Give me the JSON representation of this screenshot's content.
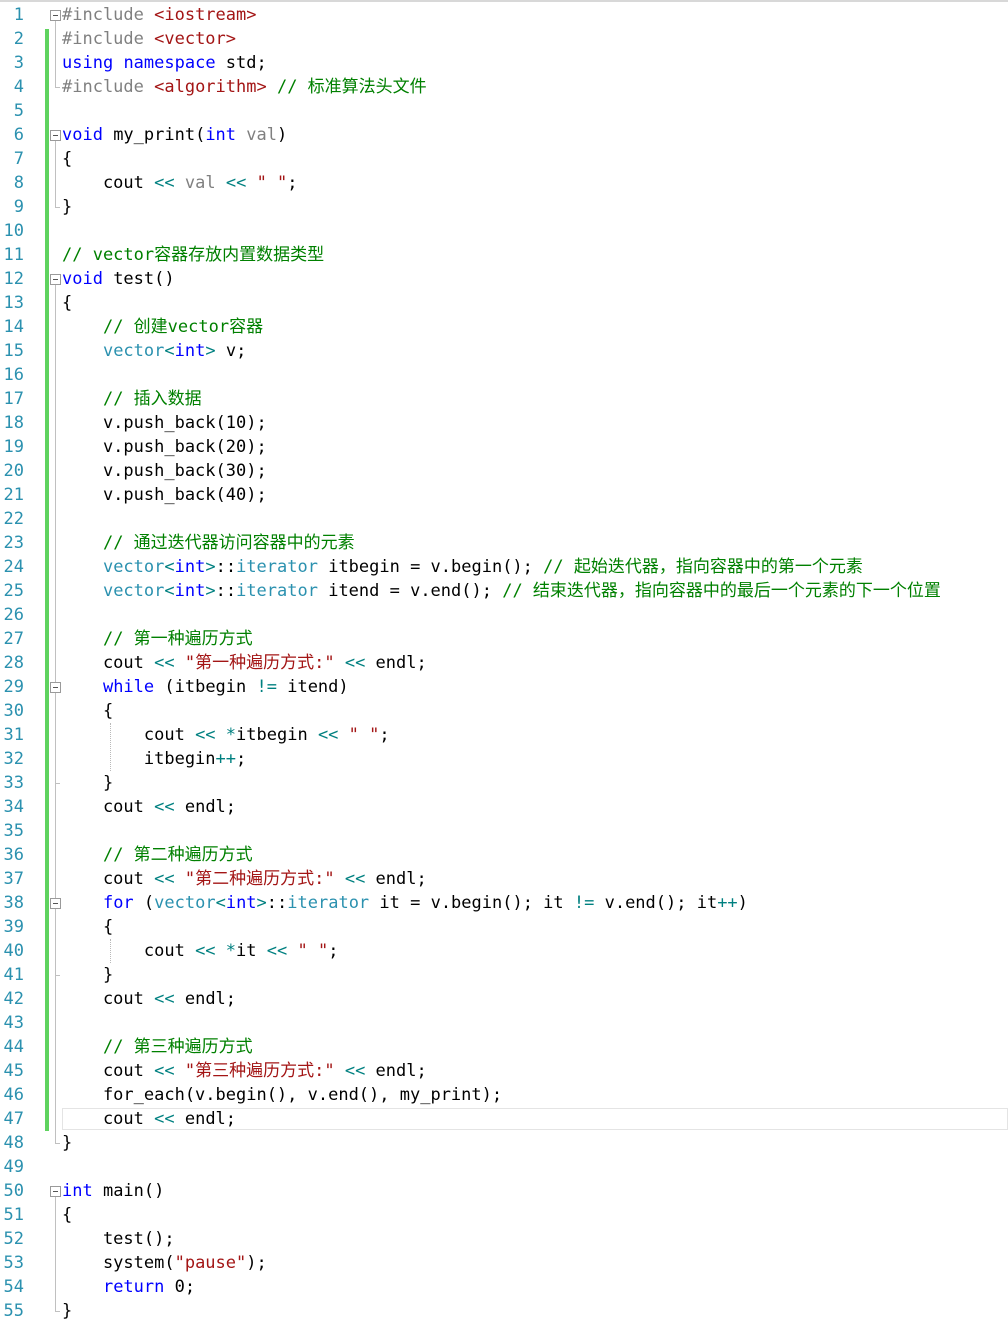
{
  "editor": {
    "language": "C++",
    "lines": [
      {
        "n": "1",
        "tokens": [
          [
            "pp",
            "#include "
          ],
          [
            "str",
            "<iostream>"
          ]
        ]
      },
      {
        "n": "2",
        "tokens": [
          [
            "pp",
            "#include "
          ],
          [
            "str",
            "<vector>"
          ]
        ]
      },
      {
        "n": "3",
        "tokens": [
          [
            "kw",
            "using"
          ],
          [
            "plain",
            " "
          ],
          [
            "kw",
            "namespace"
          ],
          [
            "plain",
            " std;"
          ]
        ]
      },
      {
        "n": "4",
        "tokens": [
          [
            "pp",
            "#include "
          ],
          [
            "str",
            "<algorithm>"
          ],
          [
            "plain",
            " "
          ],
          [
            "cm",
            "// 标准算法头文件"
          ]
        ]
      },
      {
        "n": "5",
        "tokens": []
      },
      {
        "n": "6",
        "tokens": [
          [
            "kw",
            "void"
          ],
          [
            "plain",
            " my_print("
          ],
          [
            "kw",
            "int"
          ],
          [
            "plain",
            " "
          ],
          [
            "par",
            "val"
          ],
          [
            "plain",
            ")"
          ]
        ]
      },
      {
        "n": "7",
        "tokens": [
          [
            "plain",
            "{"
          ]
        ]
      },
      {
        "n": "8",
        "tokens": [
          [
            "plain",
            "    cout "
          ],
          [
            "op",
            "<<"
          ],
          [
            "plain",
            " "
          ],
          [
            "par",
            "val"
          ],
          [
            "plain",
            " "
          ],
          [
            "op",
            "<<"
          ],
          [
            "plain",
            " "
          ],
          [
            "str",
            "\" \""
          ],
          [
            "plain",
            ";"
          ]
        ]
      },
      {
        "n": "9",
        "tokens": [
          [
            "plain",
            "}"
          ]
        ]
      },
      {
        "n": "10",
        "tokens": []
      },
      {
        "n": "11",
        "tokens": [
          [
            "cm",
            "// vector容器存放内置数据类型"
          ]
        ]
      },
      {
        "n": "12",
        "tokens": [
          [
            "kw",
            "void"
          ],
          [
            "plain",
            " test()"
          ]
        ]
      },
      {
        "n": "13",
        "tokens": [
          [
            "plain",
            "{"
          ]
        ]
      },
      {
        "n": "14",
        "tokens": [
          [
            "plain",
            "    "
          ],
          [
            "cm",
            "// 创建vector容器"
          ]
        ]
      },
      {
        "n": "15",
        "tokens": [
          [
            "plain",
            "    "
          ],
          [
            "ty",
            "vector"
          ],
          [
            "op",
            "<"
          ],
          [
            "kw",
            "int"
          ],
          [
            "op",
            ">"
          ],
          [
            "plain",
            " v;"
          ]
        ]
      },
      {
        "n": "16",
        "tokens": []
      },
      {
        "n": "17",
        "tokens": [
          [
            "plain",
            "    "
          ],
          [
            "cm",
            "// 插入数据"
          ]
        ]
      },
      {
        "n": "18",
        "tokens": [
          [
            "plain",
            "    v.push_back(10);"
          ]
        ]
      },
      {
        "n": "19",
        "tokens": [
          [
            "plain",
            "    v.push_back(20);"
          ]
        ]
      },
      {
        "n": "20",
        "tokens": [
          [
            "plain",
            "    v.push_back(30);"
          ]
        ]
      },
      {
        "n": "21",
        "tokens": [
          [
            "plain",
            "    v.push_back(40);"
          ]
        ]
      },
      {
        "n": "22",
        "tokens": []
      },
      {
        "n": "23",
        "tokens": [
          [
            "plain",
            "    "
          ],
          [
            "cm",
            "// 通过迭代器访问容器中的元素"
          ]
        ]
      },
      {
        "n": "24",
        "tokens": [
          [
            "plain",
            "    "
          ],
          [
            "ty",
            "vector"
          ],
          [
            "op",
            "<"
          ],
          [
            "kw",
            "int"
          ],
          [
            "op",
            ">"
          ],
          [
            "plain",
            "::"
          ],
          [
            "ty",
            "iterator"
          ],
          [
            "plain",
            " itbegin = v.begin(); "
          ],
          [
            "cm",
            "// 起始迭代器，指向容器中的第一个元素"
          ]
        ]
      },
      {
        "n": "25",
        "tokens": [
          [
            "plain",
            "    "
          ],
          [
            "ty",
            "vector"
          ],
          [
            "op",
            "<"
          ],
          [
            "kw",
            "int"
          ],
          [
            "op",
            ">"
          ],
          [
            "plain",
            "::"
          ],
          [
            "ty",
            "iterator"
          ],
          [
            "plain",
            " itend = v.end(); "
          ],
          [
            "cm",
            "// 结束迭代器，指向容器中的最后一个元素的下一个位置"
          ]
        ]
      },
      {
        "n": "26",
        "tokens": []
      },
      {
        "n": "27",
        "tokens": [
          [
            "plain",
            "    "
          ],
          [
            "cm",
            "// 第一种遍历方式"
          ]
        ]
      },
      {
        "n": "28",
        "tokens": [
          [
            "plain",
            "    cout "
          ],
          [
            "op",
            "<<"
          ],
          [
            "plain",
            " "
          ],
          [
            "str",
            "\"第一种遍历方式:\""
          ],
          [
            "plain",
            " "
          ],
          [
            "op",
            "<<"
          ],
          [
            "plain",
            " endl;"
          ]
        ]
      },
      {
        "n": "29",
        "tokens": [
          [
            "plain",
            "    "
          ],
          [
            "kw",
            "while"
          ],
          [
            "plain",
            " (itbegin "
          ],
          [
            "op",
            "!="
          ],
          [
            "plain",
            " itend)"
          ]
        ]
      },
      {
        "n": "30",
        "tokens": [
          [
            "plain",
            "    {"
          ]
        ]
      },
      {
        "n": "31",
        "tokens": [
          [
            "plain",
            "        cout "
          ],
          [
            "op",
            "<<"
          ],
          [
            "plain",
            " "
          ],
          [
            "op",
            "*"
          ],
          [
            "plain",
            "itbegin "
          ],
          [
            "op",
            "<<"
          ],
          [
            "plain",
            " "
          ],
          [
            "str",
            "\" \""
          ],
          [
            "plain",
            ";"
          ]
        ]
      },
      {
        "n": "32",
        "tokens": [
          [
            "plain",
            "        itbegin"
          ],
          [
            "op",
            "++"
          ],
          [
            "plain",
            ";"
          ]
        ]
      },
      {
        "n": "33",
        "tokens": [
          [
            "plain",
            "    }"
          ]
        ]
      },
      {
        "n": "34",
        "tokens": [
          [
            "plain",
            "    cout "
          ],
          [
            "op",
            "<<"
          ],
          [
            "plain",
            " endl;"
          ]
        ]
      },
      {
        "n": "35",
        "tokens": []
      },
      {
        "n": "36",
        "tokens": [
          [
            "plain",
            "    "
          ],
          [
            "cm",
            "// 第二种遍历方式"
          ]
        ]
      },
      {
        "n": "37",
        "tokens": [
          [
            "plain",
            "    cout "
          ],
          [
            "op",
            "<<"
          ],
          [
            "plain",
            " "
          ],
          [
            "str",
            "\"第二种遍历方式:\""
          ],
          [
            "plain",
            " "
          ],
          [
            "op",
            "<<"
          ],
          [
            "plain",
            " endl;"
          ]
        ]
      },
      {
        "n": "38",
        "tokens": [
          [
            "plain",
            "    "
          ],
          [
            "kw",
            "for"
          ],
          [
            "plain",
            " ("
          ],
          [
            "ty",
            "vector"
          ],
          [
            "op",
            "<"
          ],
          [
            "kw",
            "int"
          ],
          [
            "op",
            ">"
          ],
          [
            "plain",
            "::"
          ],
          [
            "ty",
            "iterator"
          ],
          [
            "plain",
            " it = v.begin(); it "
          ],
          [
            "op",
            "!="
          ],
          [
            "plain",
            " v.end(); it"
          ],
          [
            "op",
            "++"
          ],
          [
            "plain",
            ")"
          ]
        ]
      },
      {
        "n": "39",
        "tokens": [
          [
            "plain",
            "    {"
          ]
        ]
      },
      {
        "n": "40",
        "tokens": [
          [
            "plain",
            "        cout "
          ],
          [
            "op",
            "<<"
          ],
          [
            "plain",
            " "
          ],
          [
            "op",
            "*"
          ],
          [
            "plain",
            "it "
          ],
          [
            "op",
            "<<"
          ],
          [
            "plain",
            " "
          ],
          [
            "str",
            "\" \""
          ],
          [
            "plain",
            ";"
          ]
        ]
      },
      {
        "n": "41",
        "tokens": [
          [
            "plain",
            "    }"
          ]
        ]
      },
      {
        "n": "42",
        "tokens": [
          [
            "plain",
            "    cout "
          ],
          [
            "op",
            "<<"
          ],
          [
            "plain",
            " endl;"
          ]
        ]
      },
      {
        "n": "43",
        "tokens": []
      },
      {
        "n": "44",
        "tokens": [
          [
            "plain",
            "    "
          ],
          [
            "cm",
            "// 第三种遍历方式"
          ]
        ]
      },
      {
        "n": "45",
        "tokens": [
          [
            "plain",
            "    cout "
          ],
          [
            "op",
            "<<"
          ],
          [
            "plain",
            " "
          ],
          [
            "str",
            "\"第三种遍历方式:\""
          ],
          [
            "plain",
            " "
          ],
          [
            "op",
            "<<"
          ],
          [
            "plain",
            " endl;"
          ]
        ]
      },
      {
        "n": "46",
        "tokens": [
          [
            "plain",
            "    for_each(v.begin(), v.end(), my_print);"
          ]
        ]
      },
      {
        "n": "47",
        "tokens": [
          [
            "plain",
            "    cout "
          ],
          [
            "op",
            "<<"
          ],
          [
            "plain",
            " endl;"
          ]
        ]
      },
      {
        "n": "48",
        "tokens": [
          [
            "plain",
            "}"
          ]
        ]
      },
      {
        "n": "49",
        "tokens": []
      },
      {
        "n": "50",
        "tokens": [
          [
            "kw",
            "int"
          ],
          [
            "plain",
            " main()"
          ]
        ]
      },
      {
        "n": "51",
        "tokens": [
          [
            "plain",
            "{"
          ]
        ]
      },
      {
        "n": "52",
        "tokens": [
          [
            "plain",
            "    test();"
          ]
        ]
      },
      {
        "n": "53",
        "tokens": [
          [
            "plain",
            "    system("
          ],
          [
            "str",
            "\"pause\""
          ],
          [
            "plain",
            ");"
          ]
        ]
      },
      {
        "n": "54",
        "tokens": [
          [
            "plain",
            "    "
          ],
          [
            "kw",
            "return"
          ],
          [
            "plain",
            " 0;"
          ]
        ]
      },
      {
        "n": "55",
        "tokens": [
          [
            "plain",
            "}"
          ]
        ]
      }
    ],
    "fold_lines": [
      "1",
      "6",
      "12",
      "29",
      "38",
      "50"
    ],
    "changed_lines": [
      "2",
      "3",
      "4",
      "5",
      "6",
      "7",
      "8",
      "9",
      "10",
      "11",
      "12",
      "13",
      "14",
      "15",
      "16",
      "17",
      "18",
      "19",
      "20",
      "21",
      "22",
      "23",
      "24",
      "25",
      "26",
      "27",
      "28",
      "29",
      "30",
      "31",
      "32",
      "33",
      "34",
      "35",
      "36",
      "37",
      "38",
      "39",
      "40",
      "41",
      "42",
      "43",
      "44",
      "45",
      "46",
      "47"
    ],
    "current_line": "47",
    "colors": {
      "keyword": "#0000ff",
      "preprocessor": "#808080",
      "string": "#a31515",
      "comment": "#008000",
      "type": "#2b91af",
      "operator": "#008080",
      "line_number": "#2b91af",
      "change_bar": "#5fd35f"
    }
  }
}
